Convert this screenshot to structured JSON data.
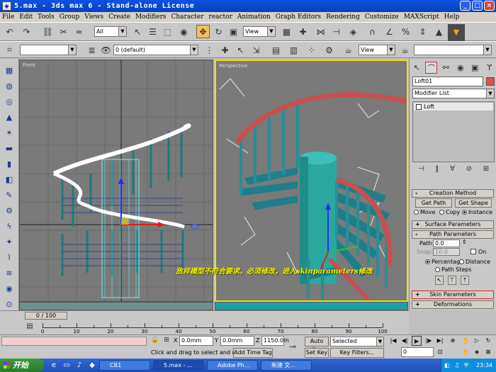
{
  "window": {
    "title": "5.max - 3ds max 6 - Stand-alone License",
    "minimize": "_",
    "maximize": "□",
    "close": "×"
  },
  "menu": [
    "File",
    "Edit",
    "Tools",
    "Group",
    "Views",
    "Create",
    "Modifiers",
    "Character",
    "reactor",
    "Animation",
    "Graph Editors",
    "Rendering",
    "Customize",
    "MAXScript",
    "Help"
  ],
  "toolbar": {
    "selection_filter": "All",
    "ref_coord": "View",
    "render_type": "View",
    "layer": "0 (default)"
  },
  "viewports": {
    "front_label": "Front",
    "perspective_label": "Perspective",
    "overlay_text": "放样模型不符合要求，必须修改，进入skinparameters修改"
  },
  "panel": {
    "object_name": "Loft01",
    "color": "#e05050",
    "modifier_list": "Modifier List",
    "stack_item": "Loft",
    "creation_method": {
      "header": "Creation Method",
      "get_path": "Get Path",
      "get_shape": "Get Shape",
      "options": [
        "Move",
        "Copy",
        "Instance"
      ],
      "selected": "Instance"
    },
    "surface_parameters": "Surface Parameters",
    "path_parameters": {
      "header": "Path Parameters",
      "path_label": "Path:",
      "path_value": "0.0",
      "snap_label": "Snap:",
      "snap_value": "10.0",
      "on_label": "On",
      "options": [
        "Percentage",
        "Distance",
        "Path Steps"
      ],
      "selected": "Percentage"
    },
    "skin_parameters": "Skin Parameters",
    "deformations": "Deformations"
  },
  "timeline": {
    "frame_display": "0 / 100",
    "ticks": [
      0,
      10,
      20,
      30,
      40,
      50,
      60,
      70,
      80,
      90,
      100
    ]
  },
  "status": {
    "x_label": "X",
    "x_value": "0.0mm",
    "y_label": "Y",
    "y_value": "0.0mm",
    "z_label": "Z",
    "z_value": "1150.0m",
    "prompt": "Click and drag to select and move",
    "add_time_tag": "Add Time Tag",
    "auto_key": "Auto Key",
    "key_mode": "Selected",
    "set_key": "Set Key",
    "key_filters": "Key Filters...",
    "current_frame": "0"
  },
  "taskbar": {
    "start": "开始",
    "tasks": [
      "CB1",
      "5.max - ...",
      "Adobe Ph...",
      "新建 文..."
    ],
    "clock": "23:34"
  }
}
